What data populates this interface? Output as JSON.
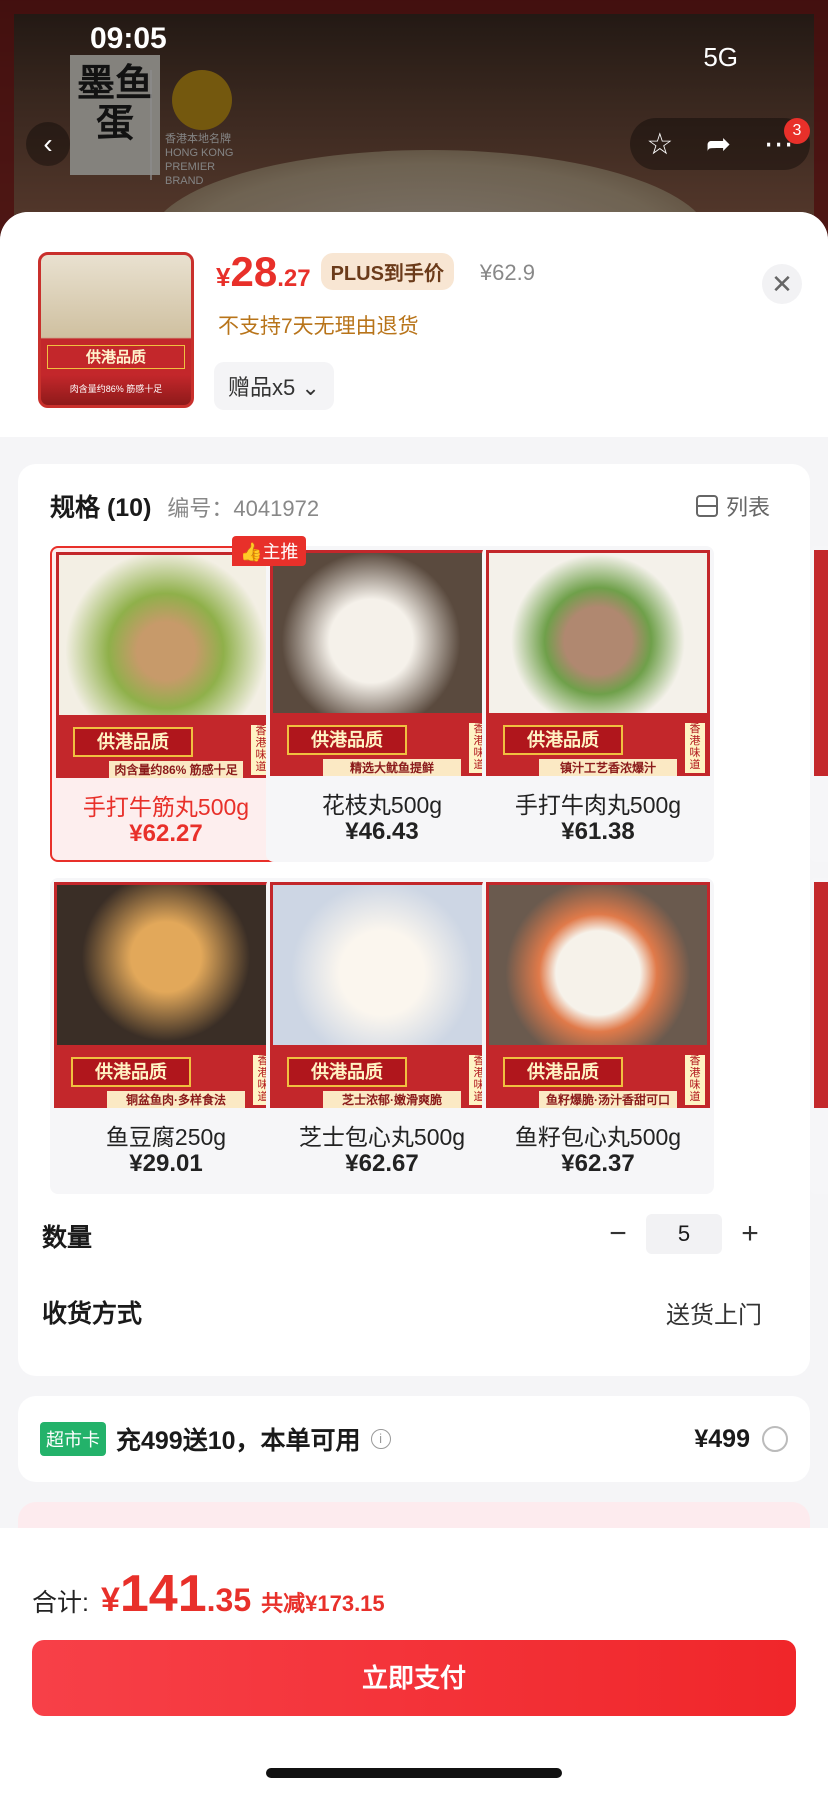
{
  "status_bar": {
    "time": "09:05",
    "network": "5G"
  },
  "background": {
    "brand": "墨鱼蛋",
    "badge_text": "香港本地名牌 HONG KONG PREMIER BRAND",
    "cart_count": "3"
  },
  "product": {
    "thumb_quality": "供港品质",
    "thumb_caption": "肉含量约86% 筋感十足",
    "price_symbol": "¥",
    "price_int": "28",
    "price_dec": ".27",
    "plus_tag": "PLUS到手价",
    "orig_price": "¥62.9",
    "no_return": "不支持7天无理由退货",
    "gift": "赠品x5 ⌄",
    "close": "✕"
  },
  "spec": {
    "title": "规格 (10)",
    "number_label": "编号：4041972",
    "view_toggle": "列表",
    "recommend_badge": "👍主推",
    "items": [
      {
        "name": "手打牛筋丸500g",
        "price": "¥62.27",
        "tagline": "肉含量约86% 筋感十足",
        "color": "#e8e0cc"
      },
      {
        "name": "花枝丸500g",
        "price": "¥46.43",
        "tagline": "精选大鱿鱼提鲜",
        "color": "#5a4a3e"
      },
      {
        "name": "手打牛肉丸500g",
        "price": "¥61.38",
        "tagline": "镇汁工艺香浓爆汁",
        "color": "#e3ddd2"
      },
      {
        "name": "鱼豆腐250g",
        "price": "¥29.01",
        "tagline": "铜盆鱼肉·多样食法",
        "color": "#3a2e26"
      },
      {
        "name": "芝士包心丸500g",
        "price": "¥62.67",
        "tagline": "芝士浓郁·嫩滑爽脆",
        "color": "#cdd6e4"
      },
      {
        "name": "鱼籽包心丸500g",
        "price": "¥62.37",
        "tagline": "鱼籽爆脆·汤汁香甜可口",
        "color": "#6a5a4e"
      }
    ],
    "quality_label": "供港品质",
    "side_label": "香港味道"
  },
  "quantity": {
    "label": "数量",
    "minus": "−",
    "value": "5",
    "plus": "+"
  },
  "delivery": {
    "label": "收货方式",
    "value": "送货上门"
  },
  "supermarket": {
    "tag": "超市卡",
    "text": "充499送10，本单可用",
    "info": "i",
    "price": "¥499"
  },
  "footer": {
    "total_label": "合计:",
    "total_symbol": "¥",
    "total_int": "141",
    "total_dec": ".35",
    "total_save": "共减¥173.15",
    "pay_label": "立即支付"
  }
}
